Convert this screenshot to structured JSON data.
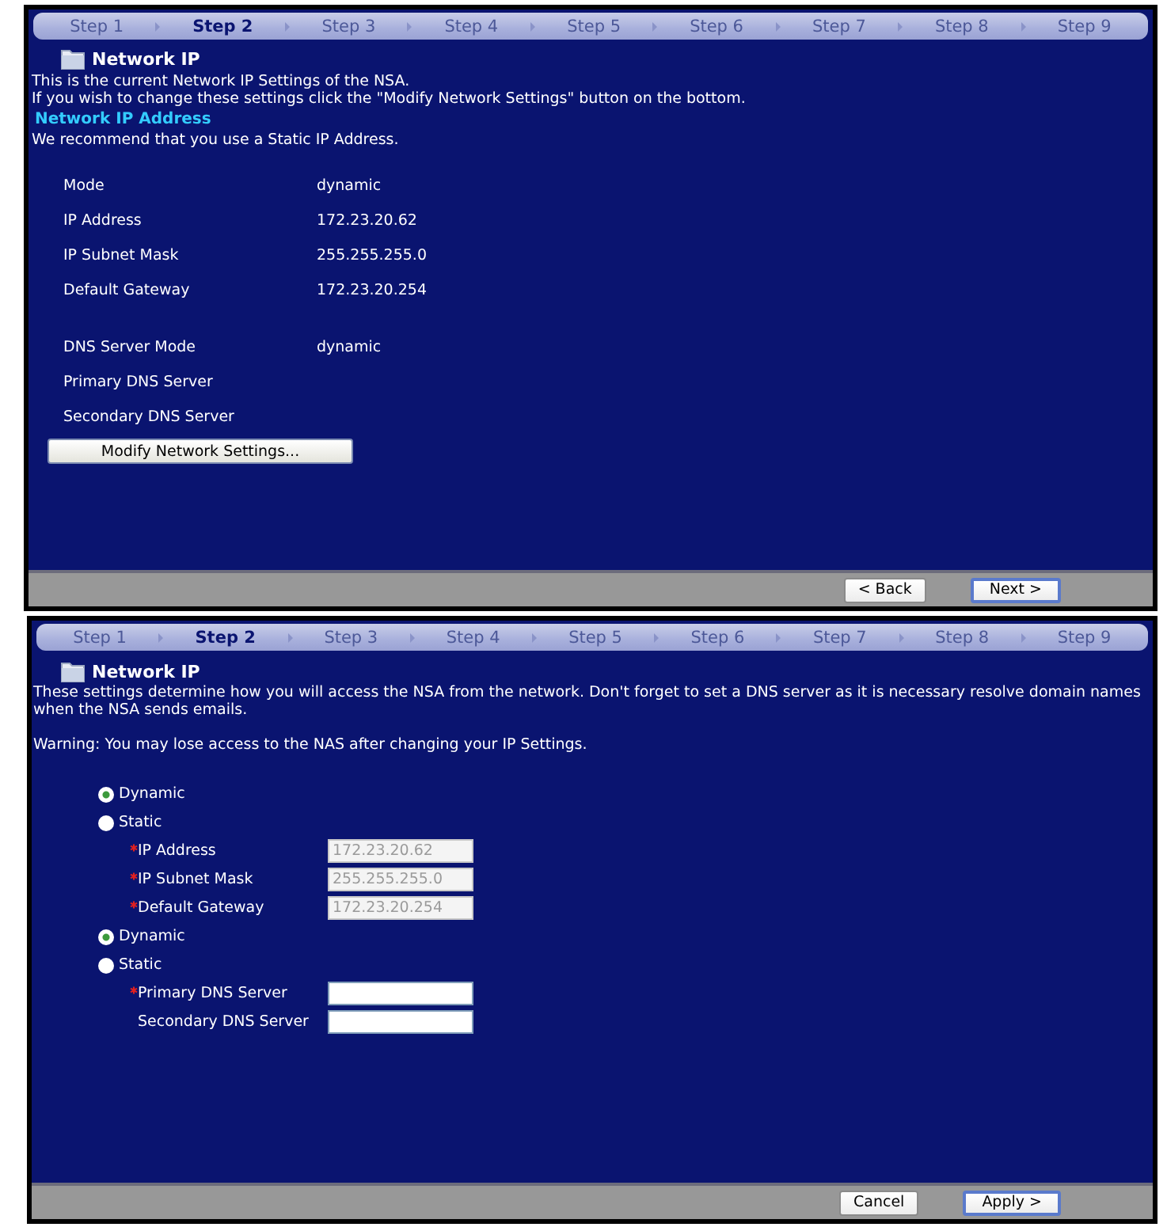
{
  "summary_panel": {
    "steps": [
      {
        "label": "Step 1",
        "selected": false
      },
      {
        "label": "Step 2",
        "selected": true
      },
      {
        "label": "Step 3",
        "selected": false
      },
      {
        "label": "Step 4",
        "selected": false
      },
      {
        "label": "Step 5",
        "selected": false
      },
      {
        "label": "Step 6",
        "selected": false
      },
      {
        "label": "Step 7",
        "selected": false
      },
      {
        "label": "Step 8",
        "selected": false
      },
      {
        "label": "Step 9",
        "selected": false
      }
    ],
    "title": "Network IP",
    "intro": [
      "This is the current Network IP Settings of the NSA.",
      "If you wish to change these settings click the \"Modify Network Settings\" button on the bottom."
    ],
    "section_heading": "Network IP Address",
    "note": "We recommend that you use a Static IP Address.",
    "setting_groups": [
      [
        {
          "label": "Mode",
          "value": "dynamic"
        },
        {
          "label": "IP Address",
          "value": "172.23.20.62"
        },
        {
          "label": "IP Subnet Mask",
          "value": "255.255.255.0"
        },
        {
          "label": "Default Gateway",
          "value": "172.23.20.254"
        }
      ],
      [
        {
          "label": "DNS Server Mode",
          "value": "dynamic"
        },
        {
          "label": "Primary DNS Server"
        },
        {
          "label": "Secondary DNS Server"
        }
      ]
    ],
    "modify_button": "Modify Network Settings...",
    "footer_buttons": [
      {
        "label": "< Back",
        "focused": false
      },
      {
        "label": "Next >",
        "focused": true
      }
    ]
  },
  "edit_panel": {
    "steps": [
      {
        "label": "Step 1",
        "selected": false
      },
      {
        "label": "Step 2",
        "selected": true
      },
      {
        "label": "Step 3",
        "selected": false
      },
      {
        "label": "Step 4",
        "selected": false
      },
      {
        "label": "Step 5",
        "selected": false
      },
      {
        "label": "Step 6",
        "selected": false
      },
      {
        "label": "Step 7",
        "selected": false
      },
      {
        "label": "Step 8",
        "selected": false
      },
      {
        "label": "Step 9",
        "selected": false
      }
    ],
    "title": "Network IP",
    "intro": "These settings determine how you will access the NSA from the network. Don't forget to set a DNS server as it is necessary resolve domain names when the NSA sends emails.",
    "warning": "Warning: You may lose access to the NAS after changing your IP Settings.",
    "rows": [
      {
        "kind": "radio",
        "label": "Dynamic",
        "selected": true
      },
      {
        "kind": "radio",
        "label": "Static",
        "selected": false
      },
      {
        "kind": "field",
        "label": "IP Address",
        "required": true,
        "value": "172.23.20.62",
        "disabled": true
      },
      {
        "kind": "field",
        "label": "IP Subnet Mask",
        "required": true,
        "value": "255.255.255.0",
        "disabled": true
      },
      {
        "kind": "field",
        "label": "Default Gateway",
        "required": true,
        "value": "172.23.20.254",
        "disabled": true
      },
      {
        "kind": "radio",
        "label": "Dynamic",
        "selected": true
      },
      {
        "kind": "radio",
        "label": "Static",
        "selected": false
      },
      {
        "kind": "field",
        "label": "Primary DNS Server",
        "required": true,
        "disabled": false
      },
      {
        "kind": "field",
        "label": "Secondary DNS Server",
        "required": false,
        "disabled": false
      }
    ],
    "footer_buttons": [
      {
        "label": "Cancel",
        "focused": false
      },
      {
        "label": "Apply >",
        "focused": true
      }
    ]
  }
}
